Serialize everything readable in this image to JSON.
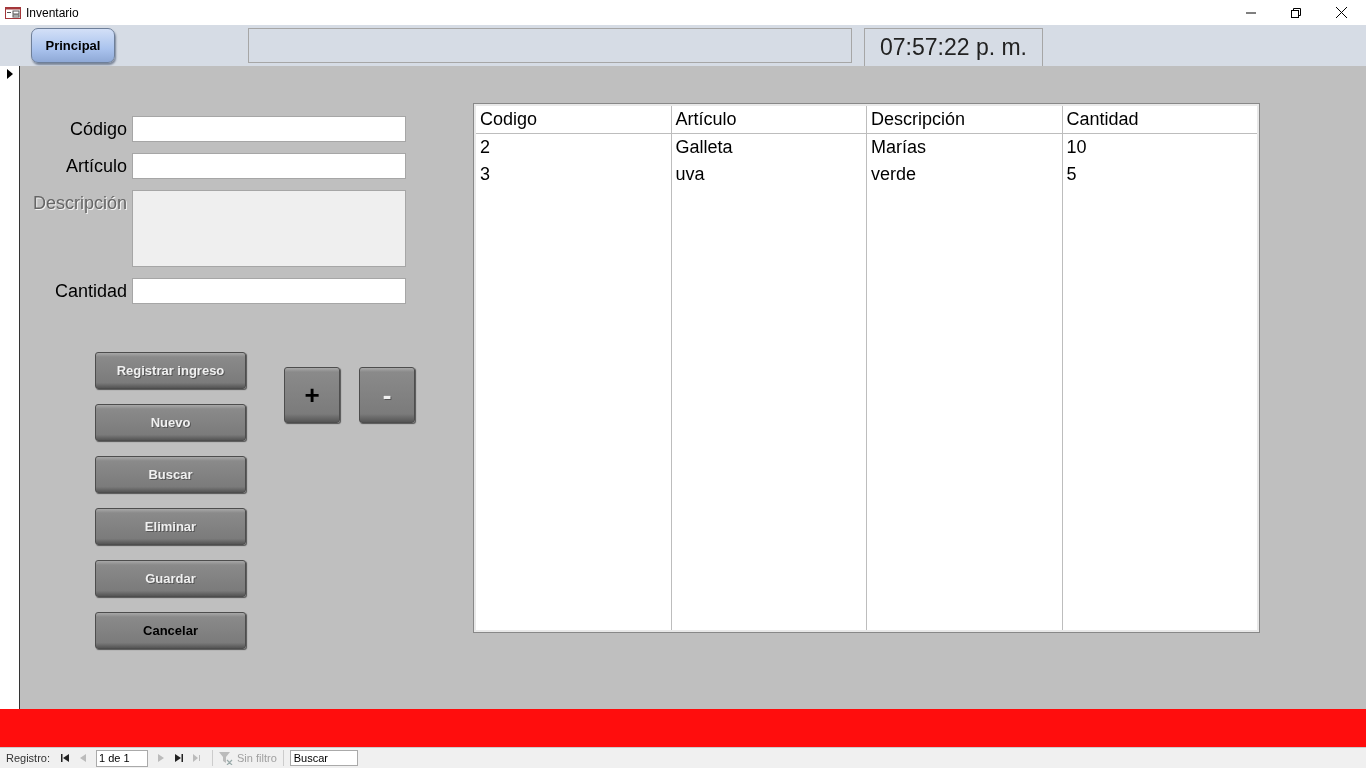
{
  "window": {
    "title": "Inventario"
  },
  "header": {
    "main_button": {
      "label": "Principal"
    },
    "clock": "07:57:22 p. m."
  },
  "form": {
    "fields": [
      {
        "label": "Código",
        "kind": "line",
        "disabled": false
      },
      {
        "label": "Artículo",
        "kind": "line",
        "disabled": false
      },
      {
        "label": "Descripción",
        "kind": "multiline",
        "disabled": true
      },
      {
        "label": "Cantidad",
        "kind": "line",
        "disabled": false
      }
    ]
  },
  "actions": [
    {
      "label": "Registrar ingreso",
      "disabled": true
    },
    {
      "label": "Nuevo",
      "disabled": true
    },
    {
      "label": "Buscar",
      "disabled": true
    },
    {
      "label": "Eliminar",
      "disabled": true
    },
    {
      "label": "Guardar",
      "disabled": true
    },
    {
      "label": "Cancelar",
      "disabled": false
    }
  ],
  "steppers": [
    {
      "label": "+",
      "disabled": false
    },
    {
      "label": "-",
      "disabled": true
    }
  ],
  "table": {
    "columns": [
      "Codigo",
      "Artículo",
      "Descripción",
      "Cantidad"
    ],
    "rows": [
      [
        "2",
        "Galleta",
        "Marías",
        "10"
      ],
      [
        "3",
        "uva",
        "verde",
        "5"
      ]
    ]
  },
  "status_bar": {
    "label": "Registro:",
    "position": "1 de 1",
    "nav_buttons": [
      {
        "kind": "first",
        "disabled": false
      },
      {
        "kind": "prev",
        "disabled": true
      }
    ],
    "nav_buttons_after": [
      {
        "kind": "next",
        "disabled": true
      },
      {
        "kind": "last",
        "disabled": false
      },
      {
        "kind": "new",
        "disabled": true
      }
    ],
    "filter": {
      "label": "Sin filtro",
      "disabled": true
    },
    "search": {
      "placeholder": "Buscar"
    }
  }
}
